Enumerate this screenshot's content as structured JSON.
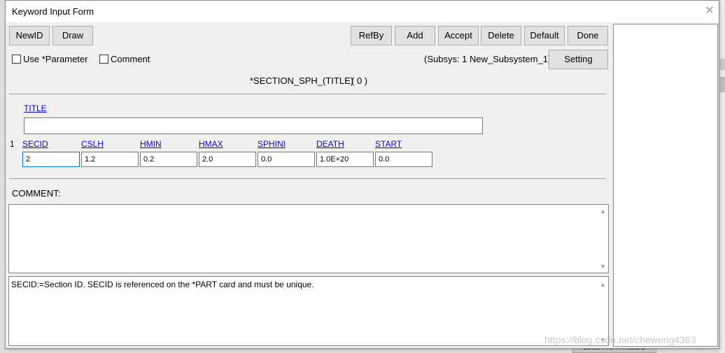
{
  "window": {
    "title": "Keyword Input Form",
    "close_icon": "close-icon"
  },
  "toolbar": {
    "newid": "NewID",
    "draw": "Draw",
    "refby": "RefBy",
    "add": "Add",
    "accept": "Accept",
    "delete": "Delete",
    "default": "Default",
    "done": "Done",
    "setting": "Setting"
  },
  "options": {
    "use_parameter": "Use *Parameter",
    "comment": "Comment",
    "subsys": "(Subsys: 1 New_Subsystem_1)"
  },
  "keyword": {
    "name": "*SECTION_SPH_(TITLE)",
    "count": "( 0 )"
  },
  "title_field": {
    "label": "TITLE",
    "value": ""
  },
  "card1": {
    "row_number": "1",
    "fields": [
      {
        "label": "SECID",
        "value": "2"
      },
      {
        "label": "CSLH",
        "value": "1.2"
      },
      {
        "label": "HMIN",
        "value": "0.2"
      },
      {
        "label": "HMAX",
        "value": "2.0"
      },
      {
        "label": "SPHINI",
        "value": "0.0"
      },
      {
        "label": "DEATH",
        "value": "1.0E+20"
      },
      {
        "label": "START",
        "value": "0.0"
      }
    ]
  },
  "comment": {
    "label": "COMMENT:",
    "value": ""
  },
  "help": {
    "text": "SECID:=Section ID. SECID is referenced on the *PART card and must be unique."
  },
  "background": {
    "bottom_button": "Load From MatDB"
  },
  "watermark": "https://blog.csdn.net/cheweng4363"
}
